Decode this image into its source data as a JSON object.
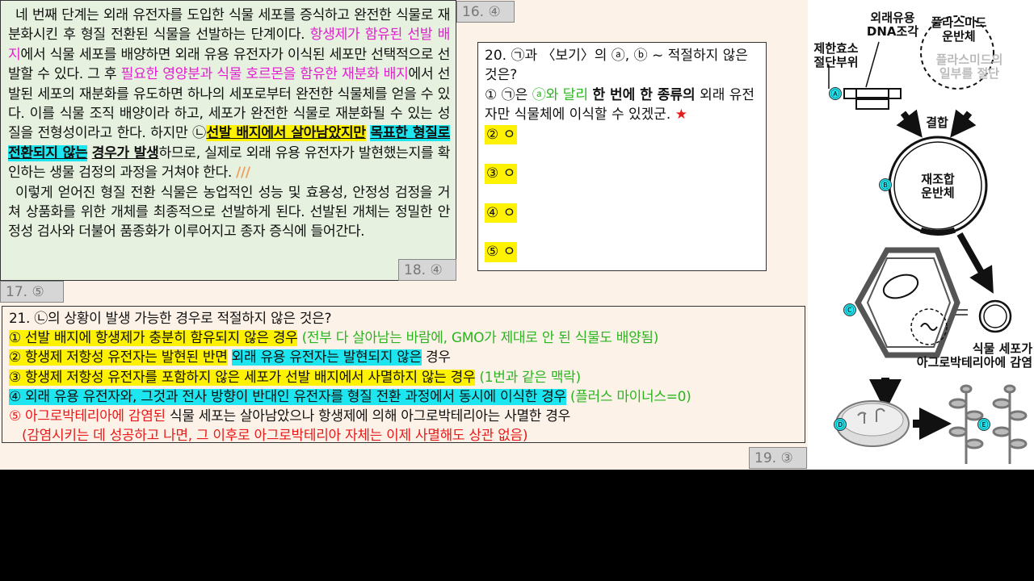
{
  "passage": {
    "p1": [
      {
        "t": "네 번째 단계는 외래 유전자를 도입한 식물 세포를 증식하고 완전한 식물로 재분화시킨 후 형질 전환된 식물을 선발하는 단계이다. ",
        "c": ""
      },
      {
        "t": "항생제가 함유된 선발 배지",
        "c": "pink"
      },
      {
        "t": "에서 식물 세포를 배양하면 외래 유용 유전자가 이식된 세포만 선택적으로 선발할 수 있다. 그 후 ",
        "c": ""
      },
      {
        "t": "필요한 영양분과 식물 호르몬을 함유한 재분화 배지",
        "c": "pink"
      },
      {
        "t": "에서 선발된 세포의 재분화를 유도하면 하나의 세포로부터 완전한 식물체를 얻을 수 있다. 이를 식물 조직 배양이라 하고, 세포가 완전한 식물로 재분화될 수 있는 성질을 전형성이라고 한다. 하지만 ㉡",
        "c": ""
      },
      {
        "t": "선발 배지에서 살아남았지만",
        "c": "hy b u"
      },
      {
        "t": " ",
        "c": ""
      },
      {
        "t": "목표한 형질로 전환되지 않는",
        "c": "hc b u"
      },
      {
        "t": " ",
        "c": ""
      },
      {
        "t": "경우가 발생",
        "c": "b u"
      },
      {
        "t": "하므로, 실제로 외래 유용 유전자가 발현했는지를 확인하는 생물 검정의 과정을 거쳐야 한다. ",
        "c": ""
      }
    ],
    "p1_mark": "///",
    "p2": "이렇게 얻어진 형질 전환 식물은 농업적인 성능 및 효용성, 안정성 검정을 거쳐 상품화를 위한 개체를 최종적으로 선발하게 된다. 선발된 개체는 정밀한 안정성 검사와 더불어 품종화가 이루어지고 종자 증식에 들어간다."
  },
  "tags": {
    "t16": "16. ④",
    "t17": "17. ⑤",
    "t18": "18. ④",
    "t19": "19. ③"
  },
  "q20": {
    "stem": "20. ㉠과 〈보기〉의 ⓐ, ⓑ ~ 적절하지 않은 것은?",
    "o1_a": "① ㉠은 ",
    "o1_b": "ⓐ와 달리",
    "o1_c": " ",
    "o1_d": "한 번에 한 종류의",
    "o1_e": " 외래 유전자만 식물체에 이식할 수 있겠군.",
    "o1_star": "★",
    "o2": "② ㅇ",
    "o3": "③ ㅇ",
    "o4": "④ ㅇ",
    "o5": "⑤ ㅇ"
  },
  "q21": {
    "stem": "21. ㉡의 상황이 발생 가능한 경우로 적절하지 않은 것은?",
    "o1": "① 선발 배지에 항생제가 충분히 함유되지 않은 경우",
    "o1_note": " (전부 다 살아남는 바람에, GMO가 제대로 안 된 식물도 배양됨)",
    "o2_a": "② 항생제 저항성 유전자는 발현된 반면",
    "o2_b": " ",
    "o2_c": "외래 유용 유전자는 발현되지 않은",
    "o2_d": " 경우",
    "o3": "③ 항생제 저항성 유전자를 포함하지 않은 세포가 선발 배지에서 사멸하지 않는 경우",
    "o3_note": " (1번과 같은 맥락)",
    "o4": "④ 외래 유용 유전자와, 그것과 전사 방향이 반대인 유전자를 형질 전환 과정에서 동시에 이식한 경우",
    "o4_note": " (플러스 마이너스=0)",
    "o5_a": "⑤ 아그로박테리아에 감염된",
    "o5_b": " 식물 세포는 살아남았으나 항생제에 의해 아그로박테리아는 사멸한 경우",
    "o5_note": "(감염시키는 데 성공하고 나면, 그 이후로 아그로박테리아 자체는 이제 사멸해도 상관 없음)"
  },
  "figure": {
    "label_dna": "외래유용\nDNA조각",
    "label_plasmid": "플라스미드\n운반체",
    "label_enzyme": "제한효소\n절단부위",
    "label_plasmid_part": "플라스미드의\n일부를 절단",
    "label_combine": "결합",
    "label_recomb": "재조합\n운반체",
    "label_infect": "식물 세포가\n아그로박테리아에 감염",
    "markers": [
      "Ⓐ",
      "Ⓑ",
      "Ⓒ",
      "Ⓓ",
      "Ⓔ"
    ]
  },
  "colors": {
    "pink": "#e31fd0",
    "green": "#2ab520",
    "red": "#e81919",
    "yellow": "#fff200",
    "cyan": "#1ee6f0",
    "passage_bg": "#e6f2df",
    "slide_bg": "#fdf2e8"
  }
}
